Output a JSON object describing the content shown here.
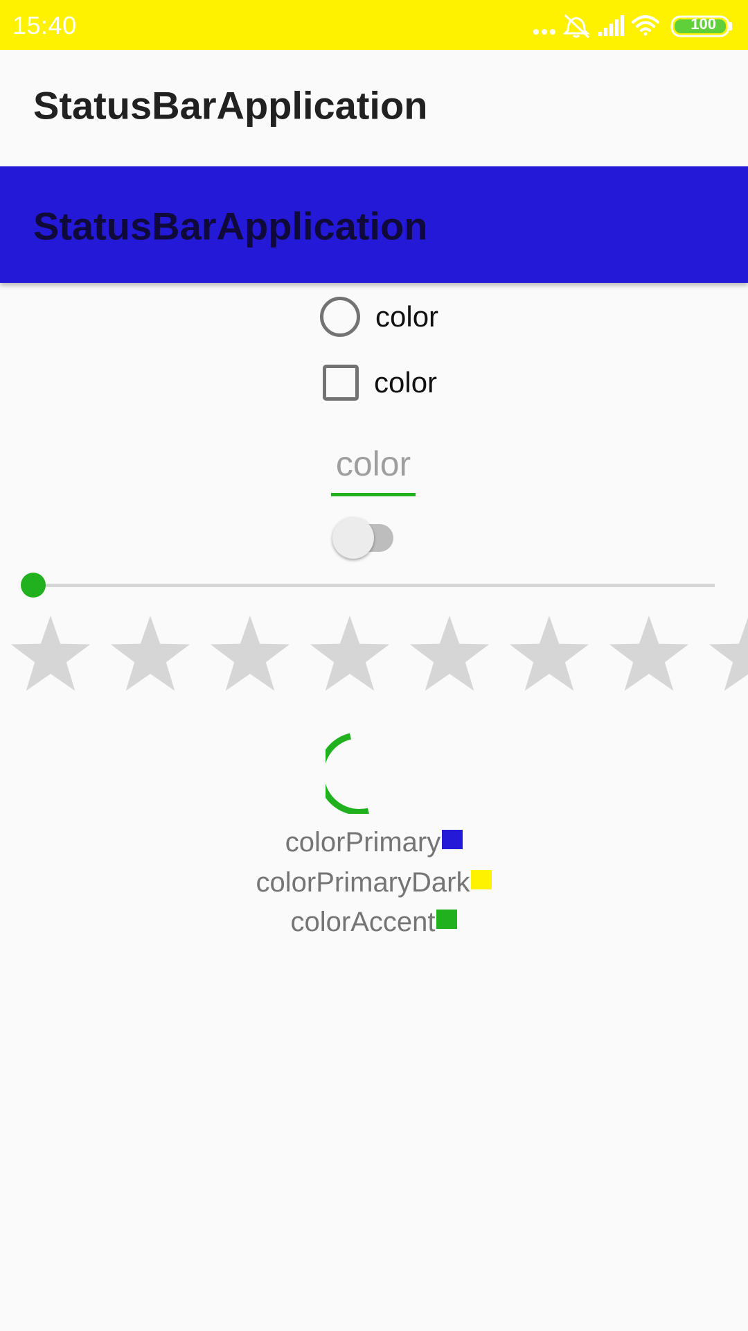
{
  "status_bar": {
    "time": "15:40",
    "battery": "100",
    "background_color": "#fff200",
    "icons": [
      "more-dots-icon",
      "bell-muted-icon",
      "signal-icon",
      "wifi-icon",
      "battery-icon"
    ]
  },
  "appbars": [
    {
      "title": "StatusBarApplication",
      "background_color": "#fafafa"
    },
    {
      "title": "StatusBarApplication",
      "background_color": "#2319d6"
    }
  ],
  "radio": {
    "label": "color",
    "checked": false
  },
  "checkbox": {
    "label": "color",
    "checked": false
  },
  "edit_text": {
    "value": "color",
    "underline_color": "#22b11e"
  },
  "switch": {
    "on": false
  },
  "seekbar": {
    "progress": 0,
    "accent_color": "#22b11e"
  },
  "rating": {
    "rating": 0,
    "stars_visible": 8,
    "star_color": "#d6d6d6"
  },
  "progress_indicator": {
    "type": "indeterminate-circular",
    "color": "#22b11e"
  },
  "color_legend": [
    {
      "label": "colorPrimary",
      "color": "#2319d6"
    },
    {
      "label": "colorPrimaryDark",
      "color": "#fff200"
    },
    {
      "label": "colorAccent",
      "color": "#22b11e"
    }
  ]
}
